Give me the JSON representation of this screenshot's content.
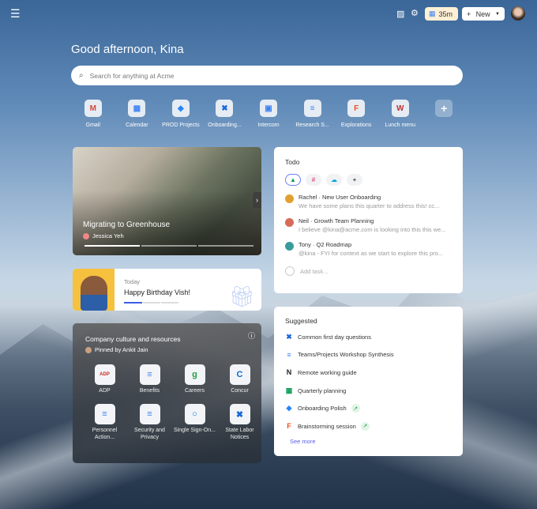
{
  "header": {
    "menu_icon": "hamburger-icon",
    "timer": "35m",
    "new_label": "New"
  },
  "greeting": "Good afternoon, Kina",
  "search": {
    "placeholder": "Search for anything at Acme"
  },
  "apps": [
    {
      "label": "Gmail",
      "icon": "M",
      "color": "#d44638"
    },
    {
      "label": "Calendar",
      "icon": "▦",
      "color": "#4285f4"
    },
    {
      "label": "PROD Projects",
      "icon": "◆",
      "color": "#2684ff"
    },
    {
      "label": "Onboarding...",
      "icon": "✖",
      "color": "#1868db"
    },
    {
      "label": "Intercom",
      "icon": "▣",
      "color": "#3b82f6"
    },
    {
      "label": "Research S...",
      "icon": "≡",
      "color": "#4285f4"
    },
    {
      "label": "Explorations",
      "icon": "F",
      "color": "#f24e1e"
    },
    {
      "label": "Lunch menu",
      "icon": "W",
      "color": "#b33"
    }
  ],
  "hero": {
    "title": "Migrating to Greenhouse",
    "author": "Jessica Yeh"
  },
  "birthday": {
    "when": "Today",
    "message": "Happy Birthday Vish!"
  },
  "culture": {
    "title": "Company culture and resources",
    "pinned": "Pinned by Ankit Jain",
    "items": [
      {
        "label": "ADP",
        "icon": "ADP",
        "color": "#d0271d"
      },
      {
        "label": "Benefits",
        "icon": "≡",
        "color": "#4285f4"
      },
      {
        "label": "Careers",
        "icon": "g",
        "color": "#24a148"
      },
      {
        "label": "Concur",
        "icon": "C",
        "color": "#0a6ed1"
      },
      {
        "label": "Personnel Action...",
        "icon": "≡",
        "color": "#4285f4"
      },
      {
        "label": "Security and Privacy",
        "icon": "≡",
        "color": "#4285f4"
      },
      {
        "label": "Single Sign-On...",
        "icon": "○",
        "color": "#0b79d0"
      },
      {
        "label": "State Labor Notices",
        "icon": "✖",
        "color": "#1868db"
      }
    ]
  },
  "todo": {
    "title": "Todo",
    "add_placeholder": "Add task...",
    "items": [
      {
        "title": "Rachel · New User Onboarding",
        "preview": "We have some plans this quarter to address this! cc...",
        "avatar": "#e0a030"
      },
      {
        "title": "Neil · Growth Team Planning",
        "preview": "I believe @kina@acme.com is looking into this this we...",
        "avatar": "#d86a5a"
      },
      {
        "title": "Tony · Q2 Roadmap",
        "preview": "@kina - FYI for context as we start to explore this pro...",
        "avatar": "#3a9a9a"
      }
    ]
  },
  "suggested": {
    "title": "Suggested",
    "see_more": "See more",
    "items": [
      {
        "label": "Common first day questions",
        "icon": "✖",
        "color": "#1868db",
        "trending": false
      },
      {
        "label": "Teams/Projects Workshop Synthesis",
        "icon": "≡",
        "color": "#4285f4",
        "trending": false
      },
      {
        "label": "Remote working guide",
        "icon": "N",
        "color": "#222",
        "trending": false
      },
      {
        "label": "Quarterly planning",
        "icon": "▦",
        "color": "#0f9d58",
        "trending": false
      },
      {
        "label": "Onboarding Polish",
        "icon": "◆",
        "color": "#2684ff",
        "trending": true
      },
      {
        "label": "Brainstorming session",
        "icon": "F",
        "color": "#f24e1e",
        "trending": true
      }
    ]
  }
}
